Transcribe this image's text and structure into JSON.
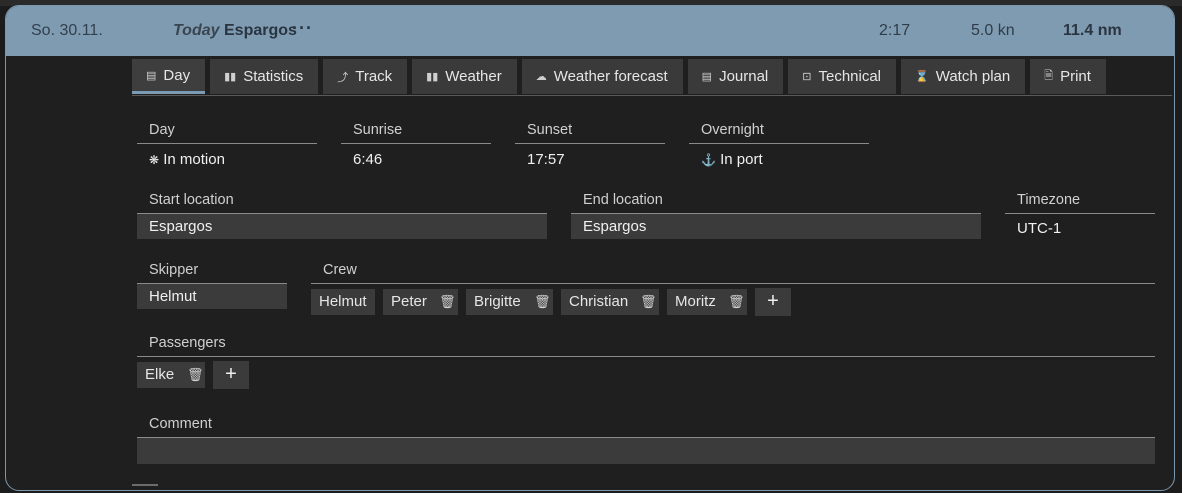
{
  "header": {
    "date": "So. 30.11.",
    "today": "Today",
    "location": "Espargos",
    "more": "···",
    "duration": "2:17",
    "speed": "5.0 kn",
    "distance": "11.4 nm"
  },
  "tabs": [
    {
      "label": "Day",
      "icon": "calendar-icon",
      "active": true
    },
    {
      "label": "Statistics",
      "icon": "bar-chart-icon"
    },
    {
      "label": "Track",
      "icon": "track-icon"
    },
    {
      "label": "Weather",
      "icon": "weather-icon"
    },
    {
      "label": "Weather forecast",
      "icon": "forecast-icon"
    },
    {
      "label": "Journal",
      "icon": "journal-icon"
    },
    {
      "label": "Technical",
      "icon": "technical-icon"
    },
    {
      "label": "Watch plan",
      "icon": "hourglass-icon"
    },
    {
      "label": "Print",
      "icon": "document-icon"
    }
  ],
  "day": {
    "label": "Day",
    "value": "In motion",
    "icon": "sun-icon"
  },
  "sunrise": {
    "label": "Sunrise",
    "value": "6:46"
  },
  "sunset": {
    "label": "Sunset",
    "value": "17:57"
  },
  "overnight": {
    "label": "Overnight",
    "value": "In port",
    "icon": "anchor-icon"
  },
  "start_location": {
    "label": "Start location",
    "value": "Espargos"
  },
  "end_location": {
    "label": "End location",
    "value": "Espargos"
  },
  "timezone": {
    "label": "Timezone",
    "value": "UTC-1"
  },
  "skipper": {
    "label": "Skipper",
    "value": "Helmut"
  },
  "crew": {
    "label": "Crew",
    "members": [
      "Helmut",
      "Peter",
      "Brigitte",
      "Christian",
      "Moritz"
    ],
    "add": "+"
  },
  "passengers": {
    "label": "Passengers",
    "members": [
      "Elke"
    ],
    "add": "+"
  },
  "comment": {
    "label": "Comment",
    "value": ""
  }
}
